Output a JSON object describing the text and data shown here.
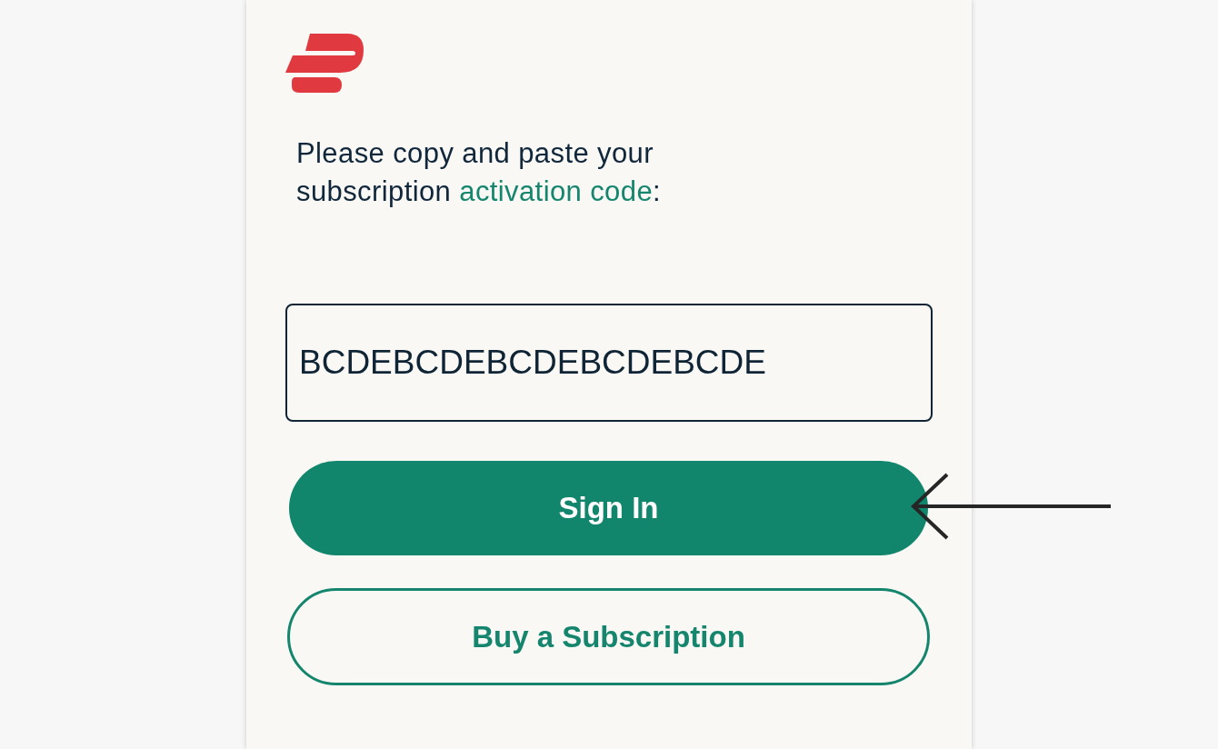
{
  "prompt": {
    "text_before": "Please copy and paste your subscription ",
    "link": "activation code",
    "text_after": ":"
  },
  "activation_field": {
    "value": "BCDEBCDEBCDEBCDEBCDE"
  },
  "buttons": [
    {
      "label": "Sign In",
      "kind": "primary"
    },
    {
      "label": "Buy a Subscription",
      "kind": "outline"
    }
  ]
}
